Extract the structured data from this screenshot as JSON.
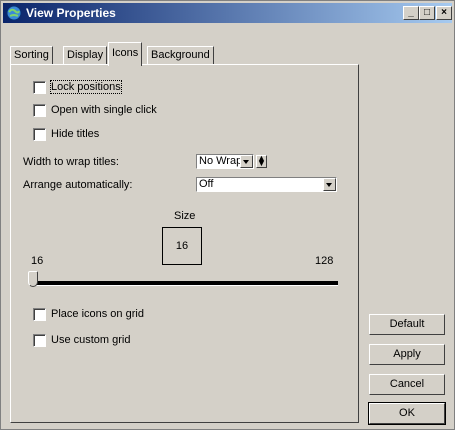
{
  "window": {
    "title": "View Properties"
  },
  "titlebar": {
    "min_glyph": "_",
    "max_glyph": "□",
    "close_glyph": "×"
  },
  "tabs": [
    {
      "label": "Sorting",
      "active": false
    },
    {
      "label": "Display",
      "active": false
    },
    {
      "label": "Icons",
      "active": true
    },
    {
      "label": "Background",
      "active": false
    }
  ],
  "icons_tab": {
    "lock_positions": {
      "label": "Lock positions",
      "checked": false
    },
    "open_single_click": {
      "label": "Open with single click",
      "checked": false
    },
    "hide_titles": {
      "label": "Hide titles",
      "checked": false
    },
    "wrap_titles": {
      "label": "Width to wrap titles:",
      "value": "No Wrap"
    },
    "arrange": {
      "label": "Arrange automatically:",
      "value": "Off"
    },
    "size": {
      "label": "Size",
      "value": "16",
      "min": "16",
      "max": "128",
      "slider_level": 0
    },
    "place_on_grid": {
      "label": "Place icons on grid",
      "checked": false
    },
    "custom_grid": {
      "label": "Use custom grid",
      "checked": false
    }
  },
  "buttons": {
    "default": "Default",
    "apply": "Apply",
    "cancel": "Cancel",
    "ok": "OK"
  }
}
